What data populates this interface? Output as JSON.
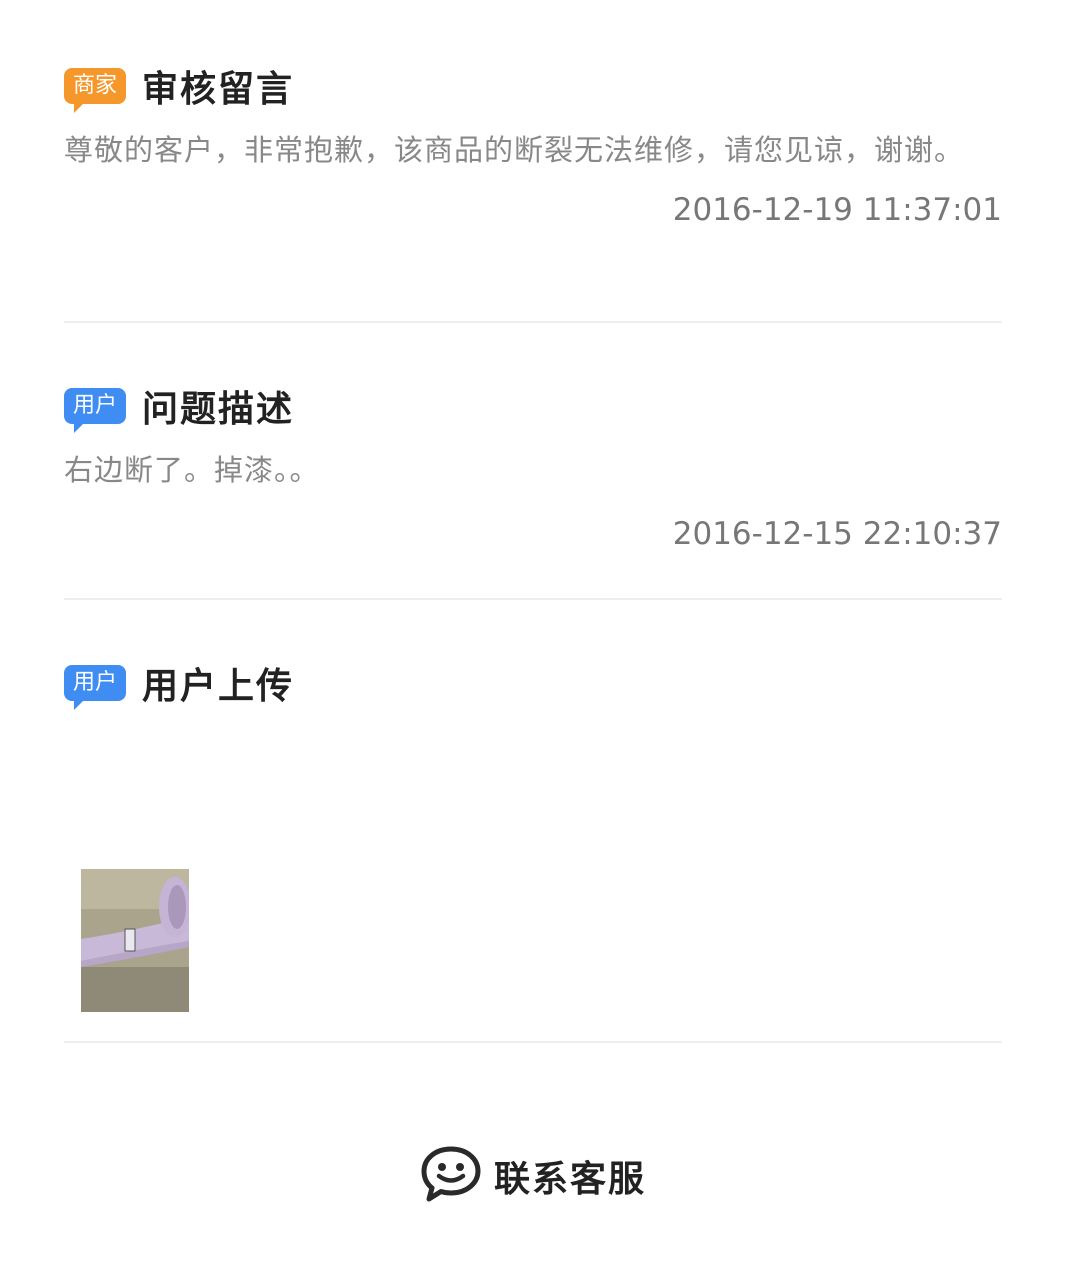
{
  "sections": [
    {
      "badge": "商家",
      "title": "审核留言",
      "text": "尊敬的客户，非常抱歉，该商品的断裂无法维修，请您见谅，谢谢。",
      "time": "2016-12-19 11:37:01"
    },
    {
      "badge": "用户",
      "title": "问题描述",
      "text": "右边断了。掉漆。。",
      "time": "2016-12-15 22:10:37"
    },
    {
      "badge": "用户",
      "title": "用户上传"
    }
  ],
  "contact": {
    "label": "联系客服",
    "icon": "chat-bubble-face-icon"
  },
  "colors": {
    "merchant_badge": "#f5972a",
    "user_badge": "#3f8cf3"
  }
}
